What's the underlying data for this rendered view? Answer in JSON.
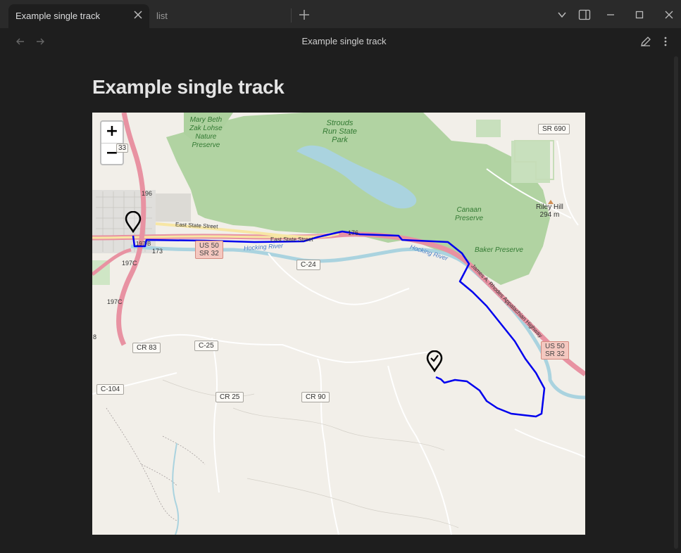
{
  "tabs": [
    {
      "label": "Example single track",
      "active": true
    },
    {
      "label": "list",
      "active": false
    }
  ],
  "header": {
    "title": "Example single track"
  },
  "page": {
    "title": "Example single track"
  },
  "map": {
    "zoom_in": "+",
    "zoom_out": "−",
    "road_shields": {
      "sr690": "SR 690",
      "cr83": "CR 83",
      "c25": "C-25",
      "c104": "C-104",
      "cr25": "CR 25",
      "cr90": "CR 90",
      "c24": "C-24",
      "us50_a_line1": "US 50",
      "us50_a_line2": "SR 32",
      "us50_b_line1": "US 50",
      "us50_b_line2": "SR 32",
      "edge33": "33"
    },
    "labels": {
      "mary_beth": "Mary Beth\nZak Lohse\nNature\nPreserve",
      "strouds": "Strouds\nRun State\nPark",
      "canaan": "Canaan\nPreserve",
      "baker": "Baker Preserve",
      "riley_hill": "Riley Hill\n294 m",
      "east_state_1": "East State Street",
      "east_state_2": "East State Street",
      "hocking_1": "Hocking River",
      "hocking_2": "Hocking River",
      "james_rhodes": "James A. Rhodes Appalachian Highway",
      "r196": "196",
      "r197c_1": "197C",
      "r197c_2": "197C",
      "r173": "173",
      "r176": "176",
      "r197b": "197-B",
      "r8": "8"
    },
    "markers": {
      "start": "pin-outline-icon",
      "end": "pin-check-icon"
    },
    "colors": {
      "track": "#0000ee",
      "park": "#add19e",
      "water": "#aad3df",
      "highway": "#e892a2",
      "land": "#f2efe9"
    }
  }
}
